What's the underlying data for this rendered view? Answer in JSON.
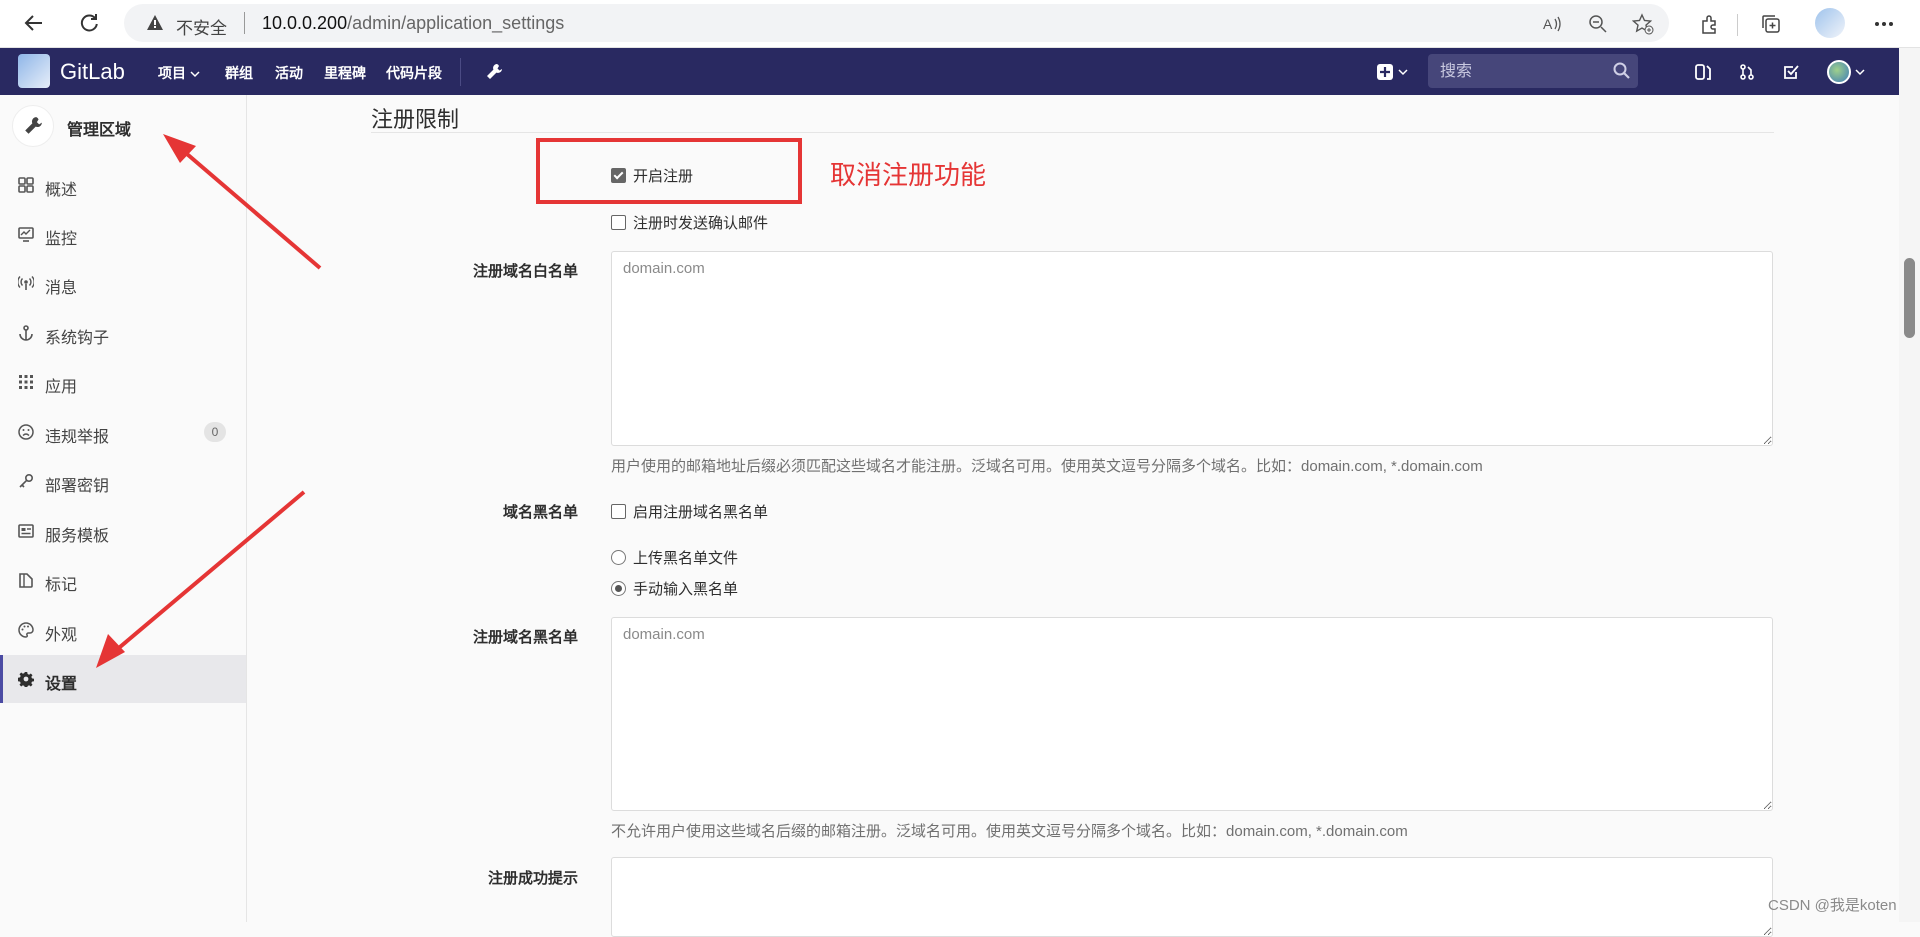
{
  "browser": {
    "security_label": "不安全",
    "url_host": "10.0.0.200",
    "url_path": "/admin/application_settings"
  },
  "gitlab": {
    "brand": "GitLab",
    "nav": {
      "projects": "项目",
      "groups": "群组",
      "activity": "活动",
      "milestones": "里程碑",
      "snippets": "代码片段"
    },
    "search_placeholder": "搜索"
  },
  "sidebar": {
    "title": "管理区域",
    "items": [
      {
        "label": "概述",
        "icon": "grid-icon"
      },
      {
        "label": "监控",
        "icon": "monitor-icon"
      },
      {
        "label": "消息",
        "icon": "broadcast-icon"
      },
      {
        "label": "系统钩子",
        "icon": "anchor-icon"
      },
      {
        "label": "应用",
        "icon": "apps-icon"
      },
      {
        "label": "违规举报",
        "icon": "frown-icon",
        "badge": "0"
      },
      {
        "label": "部署密钥",
        "icon": "key-icon"
      },
      {
        "label": "服务模板",
        "icon": "template-icon"
      },
      {
        "label": "标记",
        "icon": "label-icon"
      },
      {
        "label": "外观",
        "icon": "palette-icon"
      },
      {
        "label": "设置",
        "icon": "gear-icon",
        "active": true
      }
    ]
  },
  "content": {
    "section_title": "注册限制",
    "signup_enabled": {
      "label": "开启注册",
      "checked": true
    },
    "send_confirmation": {
      "label": "注册时发送确认邮件",
      "checked": false
    },
    "whitelist": {
      "label": "注册域名白名单",
      "placeholder": "domain.com",
      "help": "用户使用的邮箱地址后缀必须匹配这些域名才能注册。泛域名可用。使用英文逗号分隔多个域名。比如：domain.com, *.domain.com"
    },
    "blacklist_toggle": {
      "label": "域名黑名单",
      "checkbox": "启用注册域名黑名单",
      "checked": false
    },
    "blacklist_source": {
      "upload": "上传黑名单文件",
      "manual": "手动输入黑名单",
      "selected": "manual"
    },
    "blacklist": {
      "label": "注册域名黑名单",
      "placeholder": "domain.com",
      "help": "不允许用户使用这些域名后缀的邮箱注册。泛域名可用。使用英文逗号分隔多个域名。比如：domain.com, *.domain.com"
    },
    "after_signup_text": {
      "label": "注册成功提示"
    }
  },
  "annotation": {
    "note": "取消注册功能",
    "color": "#e53535"
  },
  "watermark": "CSDN @我是koten",
  "colors": {
    "header_bg": "#292961",
    "active_indicator": "#4b4ba3"
  }
}
